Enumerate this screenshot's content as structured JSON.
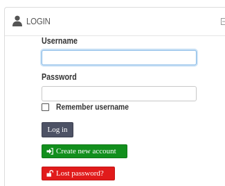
{
  "header": {
    "title": "LOGIN",
    "icon": "user-icon",
    "collapse_icon": "collapse-icon"
  },
  "form": {
    "username_label": "Username",
    "username_value": "",
    "password_label": "Password",
    "password_value": "",
    "remember_label": "Remember username",
    "remember_checked": false
  },
  "buttons": {
    "login_label": "Log in",
    "create_label": "Create new account",
    "create_icon": "sign-in-icon",
    "lost_label": "Lost password?",
    "lost_icon": "unlock-icon"
  },
  "colors": {
    "login_button": "#4d5265",
    "create_button": "#128f1d",
    "lost_button": "#e11b1b",
    "focus_border": "#7fb6e6"
  }
}
